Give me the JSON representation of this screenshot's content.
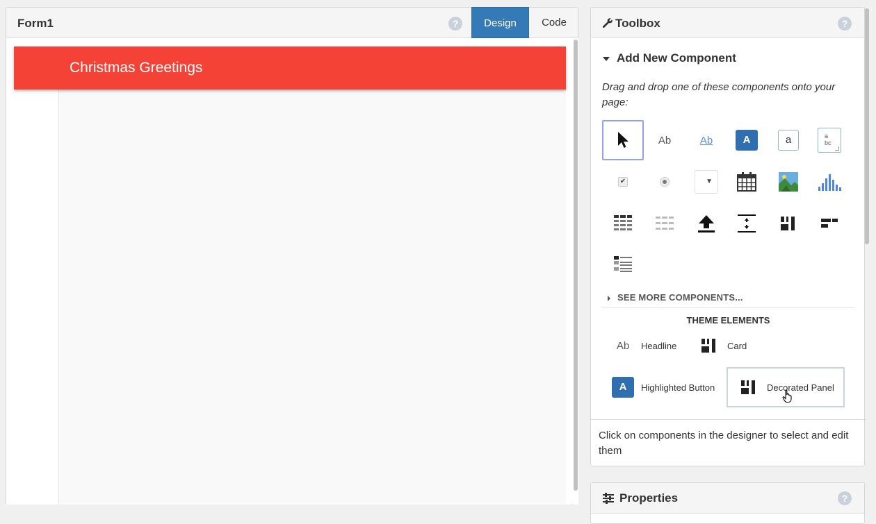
{
  "form": {
    "title": "Form1",
    "tabs": [
      "Design",
      "Code"
    ],
    "active_tab": "Design",
    "app_bar_title": "Christmas Greetings",
    "app_bar_color": "#f44336",
    "help_icon": "question-circle-icon"
  },
  "toolbox": {
    "title": "Toolbox",
    "title_icon": "wrench-icon",
    "add_new_heading": "Add New Component",
    "drag_hint": "Drag and drop one of these components onto your page:",
    "components": [
      {
        "name": "pointer",
        "icon": "pointer-icon"
      },
      {
        "name": "label",
        "icon": "label-ab-icon",
        "glyph": "Ab"
      },
      {
        "name": "link",
        "icon": "link-ab-icon",
        "glyph": "Ab"
      },
      {
        "name": "button",
        "icon": "button-a-icon",
        "glyph": "A"
      },
      {
        "name": "textbox",
        "icon": "textbox-icon",
        "glyph": "a"
      },
      {
        "name": "textarea",
        "icon": "textarea-icon",
        "glyph": "a bc"
      },
      {
        "name": "checkbox",
        "icon": "checkbox-icon"
      },
      {
        "name": "radio-button",
        "icon": "radio-icon"
      },
      {
        "name": "dropdown",
        "icon": "dropdown-icon"
      },
      {
        "name": "date-picker",
        "icon": "calendar-icon"
      },
      {
        "name": "image",
        "icon": "image-icon"
      },
      {
        "name": "plot",
        "icon": "bar-chart-icon"
      },
      {
        "name": "data-grid",
        "icon": "data-grid-icon"
      },
      {
        "name": "repeating-panel",
        "icon": "repeating-panel-icon"
      },
      {
        "name": "file-loader",
        "icon": "upload-icon"
      },
      {
        "name": "spacer",
        "icon": "spacer-icon"
      },
      {
        "name": "column-panel",
        "icon": "column-panel-icon"
      },
      {
        "name": "flow-panel",
        "icon": "flow-panel-icon"
      },
      {
        "name": "linear-panel",
        "icon": "linear-panel-icon"
      }
    ],
    "see_more": "SEE MORE COMPONENTS...",
    "theme_elements_title": "THEME ELEMENTS",
    "theme_elements": [
      {
        "label": "Headline",
        "icon": "headline-ab-icon",
        "glyph": "Ab"
      },
      {
        "label": "Card",
        "icon": "card-icon"
      },
      {
        "label": "Highlighted Button",
        "icon": "highlighted-button-icon",
        "glyph": "A"
      },
      {
        "label": "Decorated Panel",
        "icon": "decorated-panel-icon"
      }
    ],
    "footer_hint": "Click on components in the designer to select and edit them"
  },
  "properties": {
    "title": "Properties",
    "title_icon": "sliders-icon"
  },
  "colors": {
    "accent": "#337ab7",
    "app_bar": "#f44336",
    "selection_border": "#8ea3f0"
  }
}
